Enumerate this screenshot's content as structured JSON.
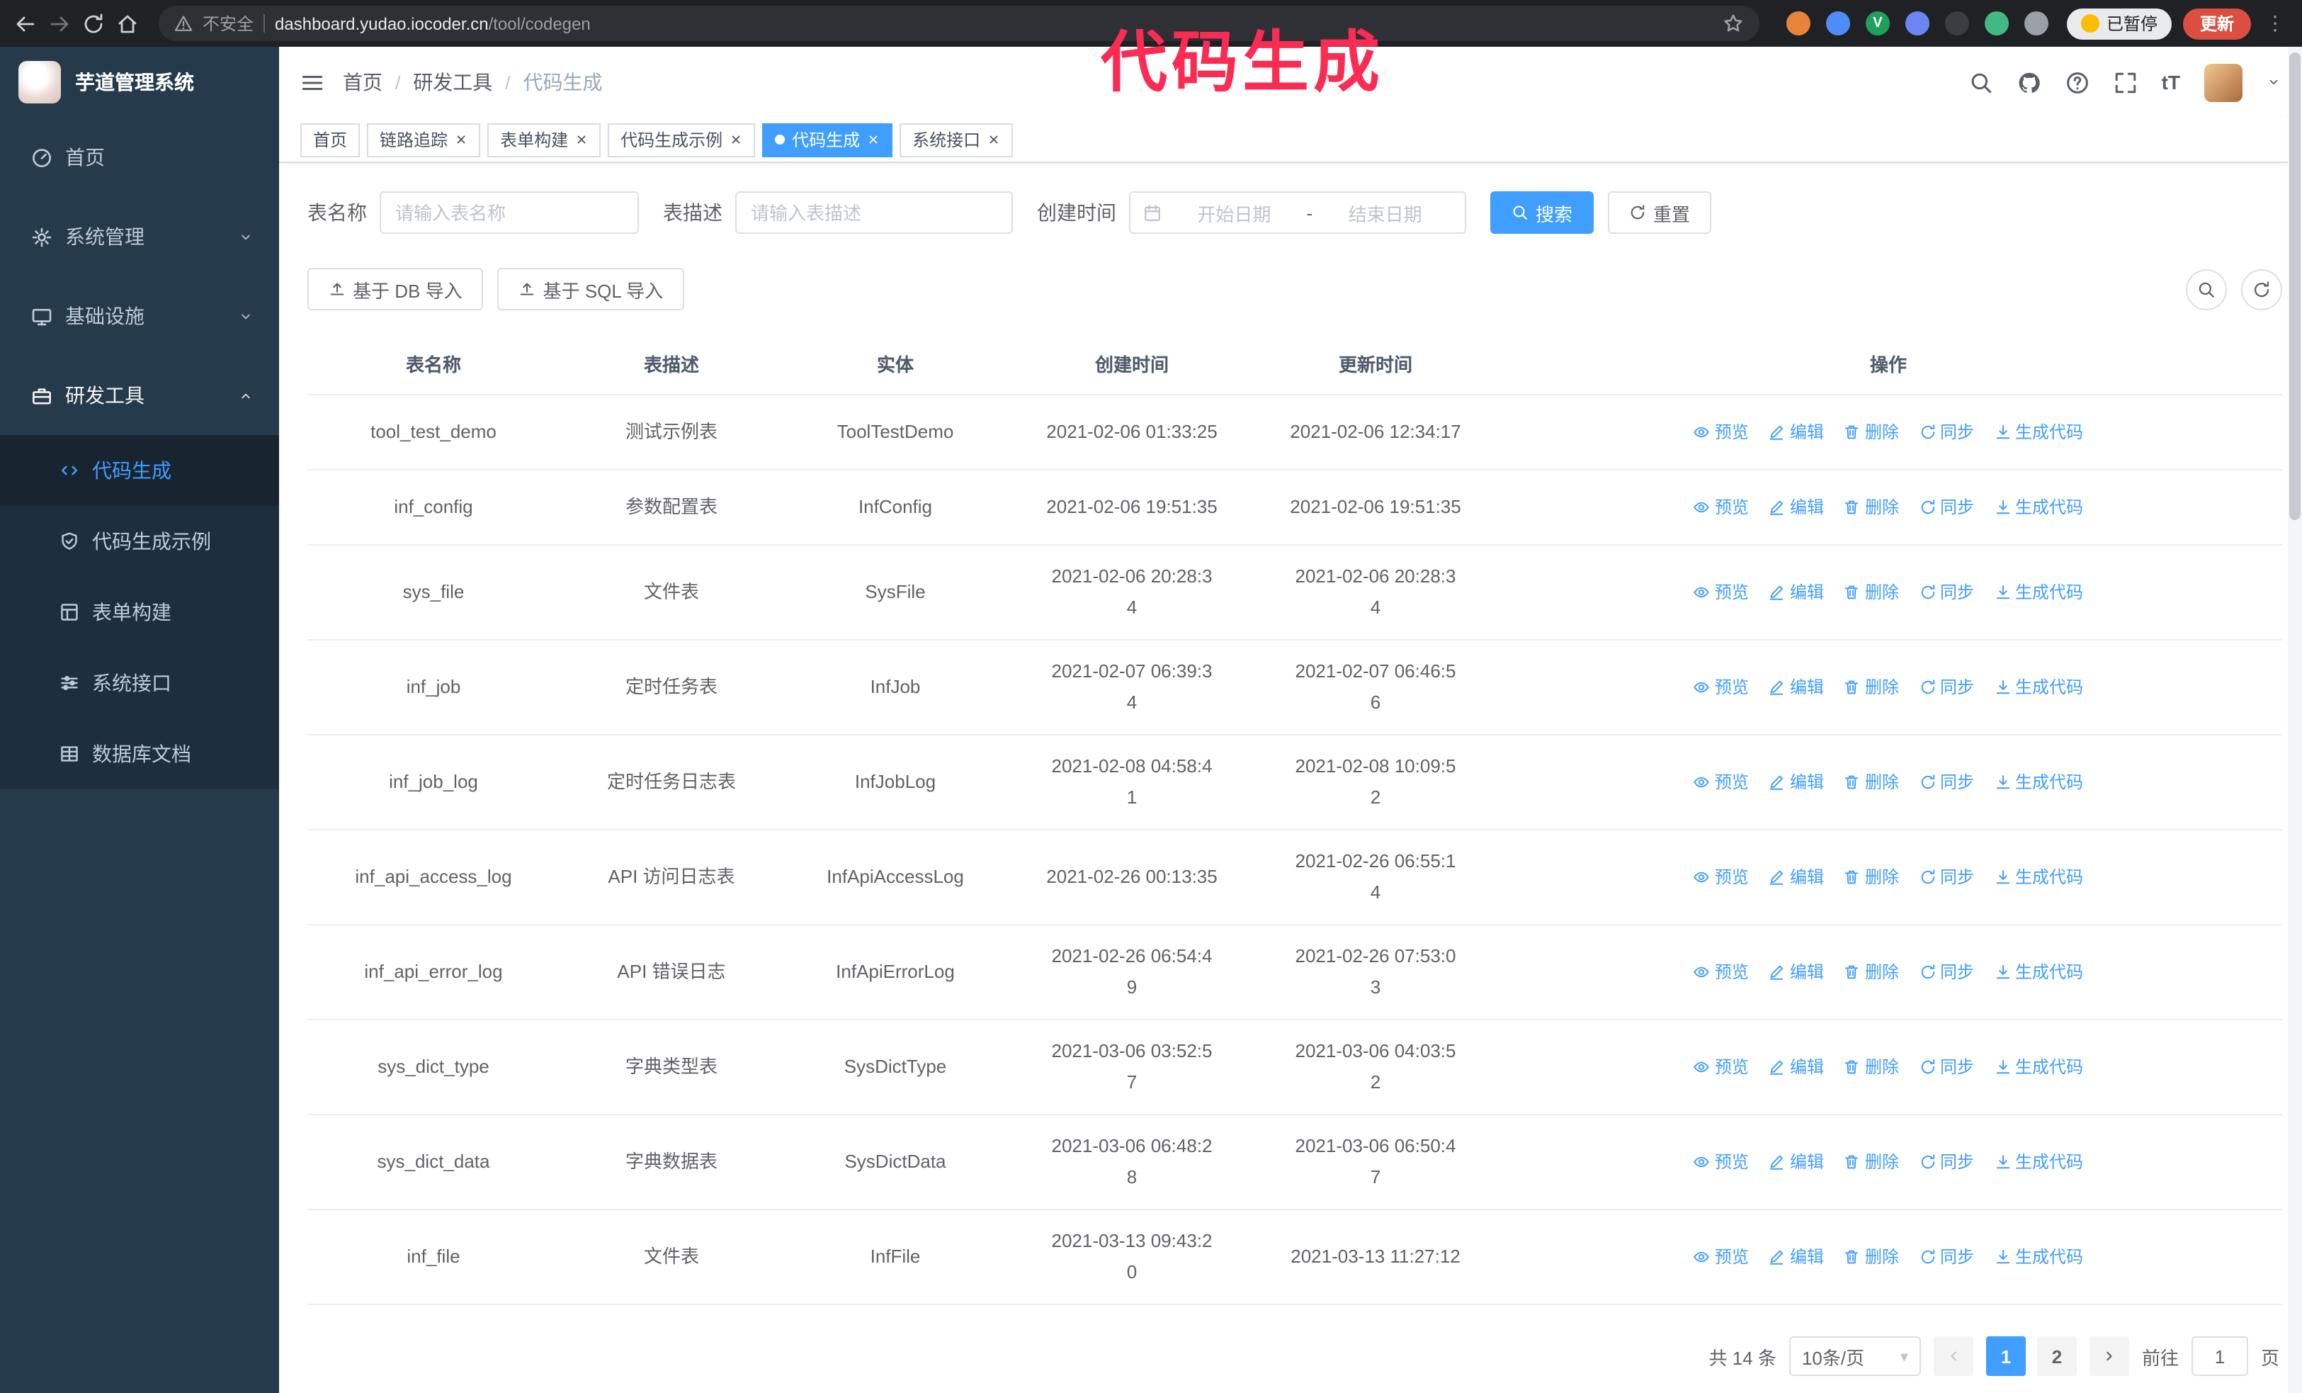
{
  "colors": {
    "primary": "#409EFF",
    "annotation": "#FA2C53",
    "update_badge": "#DC4E41"
  },
  "annotation": {
    "text": "代码生成"
  },
  "browser": {
    "security_label": "不安全",
    "url_domain": "dashboard.yudao.iocoder.cn",
    "url_path": "/tool/codegen",
    "paused_badge": "已暂停",
    "update_button": "更新",
    "extensions": [
      {
        "name": "extension-icon-orange",
        "color": "#E8833A"
      },
      {
        "name": "extension-icon-blue",
        "color": "#4E8CF7"
      },
      {
        "name": "extension-icon-green-v",
        "color": "#1FA05C",
        "glyph": "V"
      },
      {
        "name": "extension-icon-people",
        "color": "#6B86F2"
      },
      {
        "name": "extension-icon-dark",
        "color": "#3A3D42"
      },
      {
        "name": "vue-devtools-icon",
        "color": "#42B883"
      },
      {
        "name": "extensions-puzzle-icon",
        "color": "#9AA0A6"
      }
    ]
  },
  "sidebar": {
    "title": "芋道管理系统",
    "items": [
      {
        "id": "home",
        "label": "首页",
        "icon": "i-gauge"
      },
      {
        "id": "system",
        "label": "系统管理",
        "icon": "i-gear",
        "expandable": true
      },
      {
        "id": "infra",
        "label": "基础设施",
        "icon": "i-monitor",
        "expandable": true
      },
      {
        "id": "devtools",
        "label": "研发工具",
        "icon": "i-toolbox",
        "expandable": true,
        "expanded": true,
        "children": [
          {
            "id": "codegen",
            "label": "代码生成",
            "icon": "i-code",
            "active": true
          },
          {
            "id": "codegen-demo",
            "label": "代码生成示例",
            "icon": "i-shield"
          },
          {
            "id": "form-builder",
            "label": "表单构建",
            "icon": "i-form"
          },
          {
            "id": "api",
            "label": "系统接口",
            "icon": "i-sliders"
          },
          {
            "id": "db-doc",
            "label": "数据库文档",
            "icon": "i-table"
          }
        ]
      }
    ]
  },
  "header": {
    "breadcrumb": [
      "首页",
      "研发工具",
      "代码生成"
    ],
    "action_icons": [
      {
        "name": "search-icon",
        "sym": "i-search"
      },
      {
        "name": "github-icon",
        "sym": "i-github"
      },
      {
        "name": "question-icon",
        "sym": "i-question"
      },
      {
        "name": "fullscreen-icon",
        "sym": "i-expand"
      },
      {
        "name": "font-size-icon",
        "sym": "text-tt"
      }
    ]
  },
  "tabs": [
    {
      "id": "home",
      "label": "首页",
      "closable": false
    },
    {
      "id": "tracing",
      "label": "链路追踪",
      "closable": true
    },
    {
      "id": "form-builder",
      "label": "表单构建",
      "closable": true
    },
    {
      "id": "codegen-demo",
      "label": "代码生成示例",
      "closable": true
    },
    {
      "id": "codegen",
      "label": "代码生成",
      "closable": true,
      "active": true
    },
    {
      "id": "api",
      "label": "系统接口",
      "closable": true
    }
  ],
  "filters": {
    "table_name_label": "表名称",
    "table_name_placeholder": "请输入表名称",
    "table_desc_label": "表描述",
    "table_desc_placeholder": "请输入表描述",
    "created_label": "创建时间",
    "date_start_placeholder": "开始日期",
    "date_separator": "-",
    "date_end_placeholder": "结束日期",
    "search_button": "搜索",
    "reset_button": "重置"
  },
  "toolbar": {
    "import_db": "基于 DB 导入",
    "import_sql": "基于 SQL 导入"
  },
  "table": {
    "columns": [
      "表名称",
      "表描述",
      "实体",
      "创建时间",
      "更新时间",
      "操作"
    ],
    "actions": [
      {
        "id": "preview",
        "label": "预览",
        "icon": "i-eye"
      },
      {
        "id": "edit",
        "label": "编辑",
        "icon": "i-edit"
      },
      {
        "id": "delete",
        "label": "删除",
        "icon": "i-del"
      },
      {
        "id": "sync",
        "label": "同步",
        "icon": "i-sync"
      },
      {
        "id": "generate",
        "label": "生成代码",
        "icon": "i-down"
      }
    ],
    "rows": [
      {
        "name": "tool_test_demo",
        "desc": "测试示例表",
        "entity": "ToolTestDemo",
        "created": "2021-02-06 01:33:25",
        "created_wrap": false,
        "updated": "2021-02-06 12:34:17",
        "updated_wrap": false
      },
      {
        "name": "inf_config",
        "desc": "参数配置表",
        "entity": "InfConfig",
        "created": "2021-02-06 19:51:35",
        "created_wrap": false,
        "updated": "2021-02-06 19:51:35",
        "updated_wrap": false
      },
      {
        "name": "sys_file",
        "desc": "文件表",
        "entity": "SysFile",
        "created": "2021-02-06 20:28:34",
        "created_wrap": true,
        "updated": "2021-02-06 20:28:34",
        "updated_wrap": true
      },
      {
        "name": "inf_job",
        "desc": "定时任务表",
        "entity": "InfJob",
        "created": "2021-02-07 06:39:34",
        "created_wrap": true,
        "updated": "2021-02-07 06:46:56",
        "updated_wrap": true
      },
      {
        "name": "inf_job_log",
        "desc": "定时任务日志表",
        "entity": "InfJobLog",
        "created": "2021-02-08 04:58:41",
        "created_wrap": true,
        "updated": "2021-02-08 10:09:52",
        "updated_wrap": true
      },
      {
        "name": "inf_api_access_log",
        "desc": "API 访问日志表",
        "entity": "InfApiAccessLog",
        "created": "2021-02-26 00:13:35",
        "created_wrap": false,
        "updated": "2021-02-26 06:55:14",
        "updated_wrap": true
      },
      {
        "name": "inf_api_error_log",
        "desc": "API 错误日志",
        "entity": "InfApiErrorLog",
        "created": "2021-02-26 06:54:49",
        "created_wrap": true,
        "updated": "2021-02-26 07:53:03",
        "updated_wrap": true
      },
      {
        "name": "sys_dict_type",
        "desc": "字典类型表",
        "entity": "SysDictType",
        "created": "2021-03-06 03:52:57",
        "created_wrap": true,
        "updated": "2021-03-06 04:03:52",
        "updated_wrap": true
      },
      {
        "name": "sys_dict_data",
        "desc": "字典数据表",
        "entity": "SysDictData",
        "created": "2021-03-06 06:48:28",
        "created_wrap": true,
        "updated": "2021-03-06 06:50:47",
        "updated_wrap": true
      },
      {
        "name": "inf_file",
        "desc": "文件表",
        "entity": "InfFile",
        "created": "2021-03-13 09:43:20",
        "created_wrap": true,
        "updated": "2021-03-13 11:27:12",
        "updated_wrap": false
      }
    ]
  },
  "pagination": {
    "total_text": "共 14 条",
    "page_size": "10条/页",
    "pages": [
      "1",
      "2"
    ],
    "active_page": "1",
    "goto_label": "前往",
    "goto_value": "1",
    "goto_suffix": "页"
  }
}
